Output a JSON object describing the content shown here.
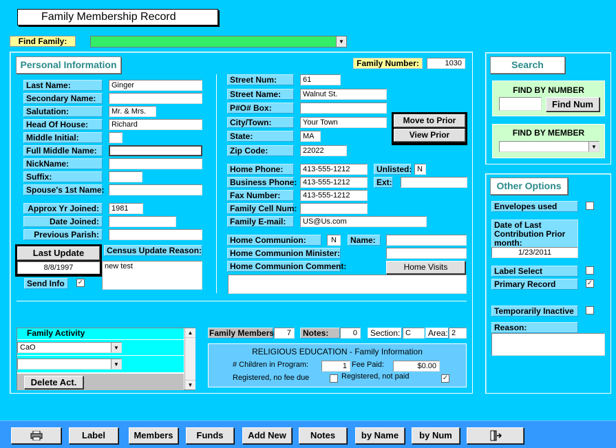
{
  "window": {
    "title": "Family Membership Record"
  },
  "find": {
    "label": "Find Family:",
    "value": ""
  },
  "personal": {
    "title": "Personal Information",
    "family_number_label": "Family Number:",
    "family_number": "1030",
    "fields": [
      {
        "label": "Last Name:",
        "value": "Ginger"
      },
      {
        "label": "Secondary Name:",
        "value": ""
      },
      {
        "label": "Salutation:",
        "value": "Mr. & Mrs."
      },
      {
        "label": "Head Of House:",
        "value": "Richard"
      },
      {
        "label": "Middle Initial:",
        "value": ""
      },
      {
        "label": "Full Middle Name:",
        "value": ""
      },
      {
        "label": "NickName:",
        "value": ""
      },
      {
        "label": "Suffix:",
        "value": ""
      },
      {
        "label": "Spouse's 1st Name:",
        "value": ""
      }
    ],
    "approx_yr_label": "Approx Yr Joined:",
    "approx_yr": "1981",
    "date_joined_label": "Date Joined:",
    "date_joined": "",
    "prev_parish_label": "Previous Parish:",
    "prev_parish": "",
    "last_update_label": "Last Update",
    "last_update": "8/8/1997",
    "census_label": "Census Update Reason:",
    "census_reason": "new test",
    "send_info_label": "Send Info",
    "send_info_checked": "✓"
  },
  "address": {
    "street_num_label": "Street Num:",
    "street_num": "61",
    "street_name_label": "Street Name:",
    "street_name": "Walnut St.",
    "pobox_label": "P#O# Box:",
    "pobox": "",
    "city_label": "City/Town:",
    "city": "Your Town",
    "state_label": "State:",
    "state": "MA",
    "zip_label": "Zip Code:",
    "zip": "22022",
    "move_prior": "Move to Prior",
    "view_prior": "View Prior",
    "home_phone_label": "Home Phone:",
    "home_phone": "413-555-1212",
    "unlisted_label": "Unlisted:",
    "unlisted": "N",
    "business_phone_label": "Business Phone:",
    "business_phone": "413-555-1212",
    "ext_label": "Ext:",
    "ext": "",
    "fax_label": "Fax Number:",
    "fax": "413-555-1212",
    "cell_label": "Family Cell Num:",
    "cell": "",
    "email_label": "Family E-mail:",
    "email": "US@Us.com",
    "home_comm_label": "Home Communion:",
    "home_comm": "N",
    "name_label": "Name:",
    "name": "",
    "minister_label": "Home Communion Minister:",
    "minister": "",
    "comment_label": "Home Communion Comment:",
    "comment": "",
    "home_visits": "Home Visits"
  },
  "activity": {
    "title": "Family Activity",
    "items": [
      "CaO",
      ""
    ],
    "delete_label": "Delete Act."
  },
  "stats": {
    "members_label": "Family Members:",
    "members": "7",
    "notes_label": "Notes:",
    "notes": "0",
    "section_label": "Section:",
    "section": "C",
    "area_label": "Area:",
    "area": "2"
  },
  "religious": {
    "title": "RELIGIOUS EDUCATION - Family Information",
    "children_label": "# Children in Program:",
    "children": "1",
    "fee_label": "Fee Paid:",
    "fee": "$0.00",
    "reg_nofee_label": "Registered, no fee due",
    "reg_notpaid_label": "Registered, not paid",
    "reg_notpaid_checked": "✓"
  },
  "search": {
    "title": "Search",
    "by_number_title": "FIND BY NUMBER",
    "find_num": "Find Num",
    "by_member_title": "FIND BY MEMBER"
  },
  "options": {
    "title": "Other Options",
    "envelopes_label": "Envelopes used",
    "last_contrib_label": "Date of Last Contribution Prior month:",
    "last_contrib": "1/23/2011",
    "label_select_label": "Label Select",
    "primary_label": "Primary Record",
    "primary_checked": "✓",
    "temp_inactive_label": "Temporarily Inactive",
    "reason_label": "Reason:",
    "reason": ""
  },
  "toolbar": {
    "print_icon": "printer-icon",
    "label": "Label",
    "members": "Members",
    "funds": "Funds",
    "add_new": "Add New",
    "notes": "Notes",
    "by_name": "by Name",
    "by_num": "by Num",
    "exit_icon": "exit-door-icon"
  }
}
